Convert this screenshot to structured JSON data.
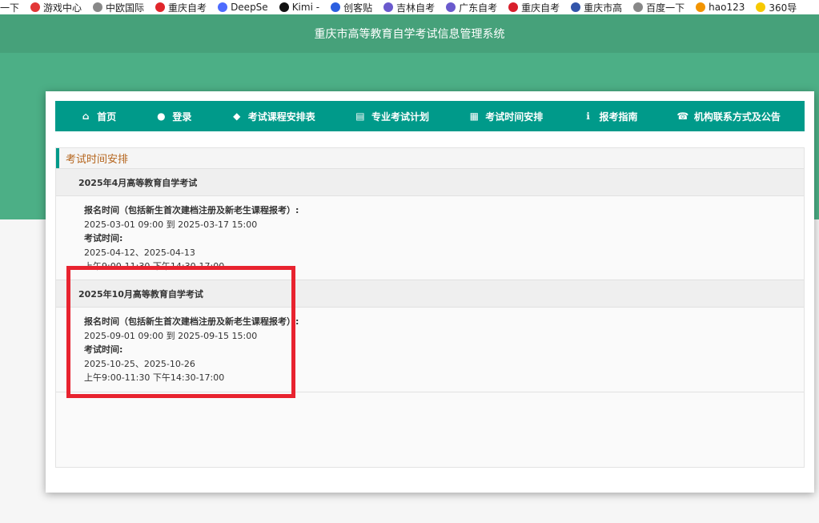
{
  "bookmarks": [
    {
      "label": "一下",
      "icon": "none",
      "color": "#ffffff"
    },
    {
      "label": "游戏中心",
      "icon": "game-icon",
      "color": "#e23636"
    },
    {
      "label": "中欧国际",
      "icon": "globe-icon",
      "color": "#888888"
    },
    {
      "label": "重庆自考",
      "icon": "opera-icon",
      "color": "#e0262b"
    },
    {
      "label": "DeepSe",
      "icon": "deepseek-icon",
      "color": "#4d6bfe"
    },
    {
      "label": "Kimi -",
      "icon": "kimi-icon",
      "color": "#111111"
    },
    {
      "label": "创客贴",
      "icon": "chuangke-icon",
      "color": "#2b5fe0"
    },
    {
      "label": "吉林自考",
      "icon": "jilin-icon",
      "color": "#6a5acd"
    },
    {
      "label": "广东自考",
      "icon": "guangdong-icon",
      "color": "#6a5acd"
    },
    {
      "label": "重庆自考",
      "icon": "k-icon",
      "color": "#d81e2b"
    },
    {
      "label": "重庆市高",
      "icon": "pen-icon",
      "color": "#3355aa"
    },
    {
      "label": "百度一下",
      "icon": "globe-icon",
      "color": "#888888"
    },
    {
      "label": "hao123",
      "icon": "hao-icon",
      "color": "#f29400"
    },
    {
      "label": "360导",
      "icon": "360-icon",
      "color": "#f7c900"
    }
  ],
  "header": {
    "title": "重庆市高等教育自学考试信息管理系统"
  },
  "nav": [
    {
      "label": "首页",
      "icon": "home-icon",
      "glyph": "⌂"
    },
    {
      "label": "登录",
      "icon": "user-icon",
      "glyph": "●"
    },
    {
      "label": "考试课程安排表",
      "icon": "graduation-cap-icon",
      "glyph": "◆"
    },
    {
      "label": "专业考试计划",
      "icon": "newspaper-icon",
      "glyph": "▤"
    },
    {
      "label": "考试时间安排",
      "icon": "calendar-icon",
      "glyph": "▦"
    },
    {
      "label": "报考指南",
      "icon": "info-icon",
      "glyph": "ℹ"
    },
    {
      "label": "机构联系方式及公告",
      "icon": "phone-icon",
      "glyph": "☎"
    }
  ],
  "panel": {
    "title": "考试时间安排",
    "sections": [
      {
        "heading": "2025年4月高等教育自学考试",
        "reg_label": "报名时间（包括新生首次建档注册及新老生课程报考）:",
        "reg_time": "2025-03-01 09:00   到   2025-03-17 15:00",
        "exam_label": "考试时间:",
        "exam_dates": "2025-04-12、2025-04-13",
        "exam_hours": "上午9:00-11:30   下午14:30-17:00"
      },
      {
        "heading": "2025年10月高等教育自学考试",
        "reg_label": "报名时间（包括新生首次建档注册及新老生课程报考）:",
        "reg_time": "2025-09-01 09:00   到   2025-09-15 15:00",
        "exam_label": "考试时间:",
        "exam_dates": "2025-10-25、2025-10-26",
        "exam_hours": "上午9:00-11:30   下午14:30-17:00"
      }
    ]
  },
  "annotation": {
    "color": "#e8232f"
  }
}
